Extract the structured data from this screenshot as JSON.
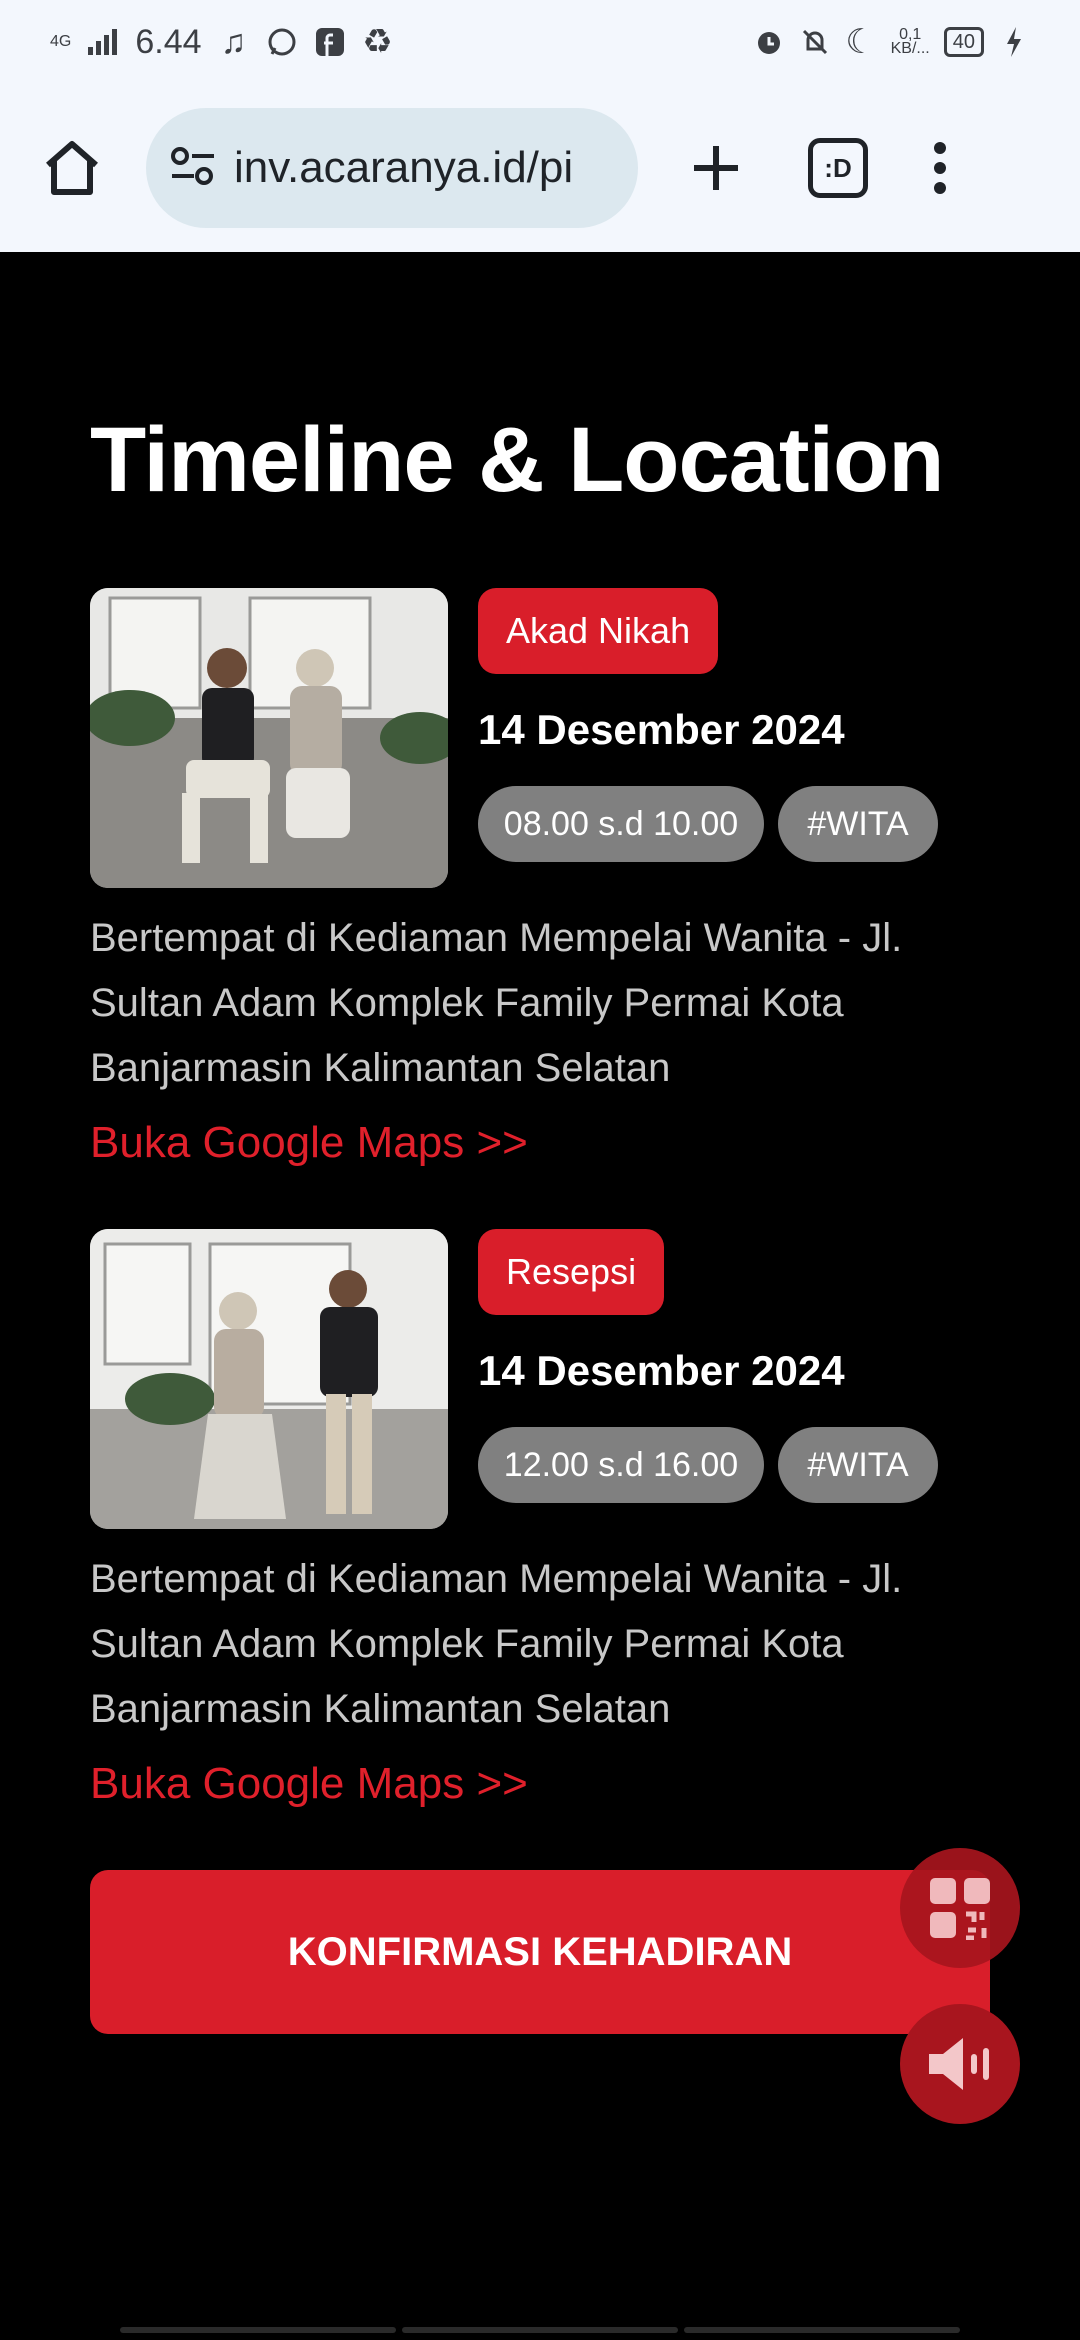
{
  "status_bar": {
    "network": "4G",
    "time": "6.44",
    "speed_top": "0,1",
    "speed_bottom": "KB/...",
    "battery": "40"
  },
  "browser": {
    "url": "inv.acaranya.id/pi",
    "tabs_label": ":D"
  },
  "page": {
    "title": "Timeline & Location"
  },
  "events": [
    {
      "badge": "Akad Nikah",
      "date": "14 Desember 2024",
      "time": "08.00 s.d 10.00",
      "timezone": "#WITA",
      "address": "Bertempat di Kediaman Mempelai Wanita - Jl. Sultan Adam Komplek Family Permai Kota Banjarmasin Kalimantan Selatan",
      "maps_label": "Buka Google Maps >>"
    },
    {
      "badge": "Resepsi",
      "date": "14 Desember 2024",
      "time": "12.00 s.d 16.00",
      "timezone": "#WITA",
      "address": "Bertempat di Kediaman Mempelai Wanita - Jl. Sultan Adam Komplek Family Permai Kota Banjarmasin Kalimantan Selatan",
      "maps_label": "Buka Google Maps >>"
    }
  ],
  "rsvp": {
    "label": "KONFIRMASI KEHADIRAN"
  },
  "colors": {
    "accent": "#d91e2a",
    "background": "#000000",
    "pill": "#808080",
    "link": "#e0202b"
  },
  "icons": {
    "home": "home-icon",
    "site_settings": "site-settings-icon",
    "new_tab": "plus-icon",
    "menu": "more-vert-icon",
    "qr": "qr-code-icon",
    "sound": "speaker-icon"
  }
}
